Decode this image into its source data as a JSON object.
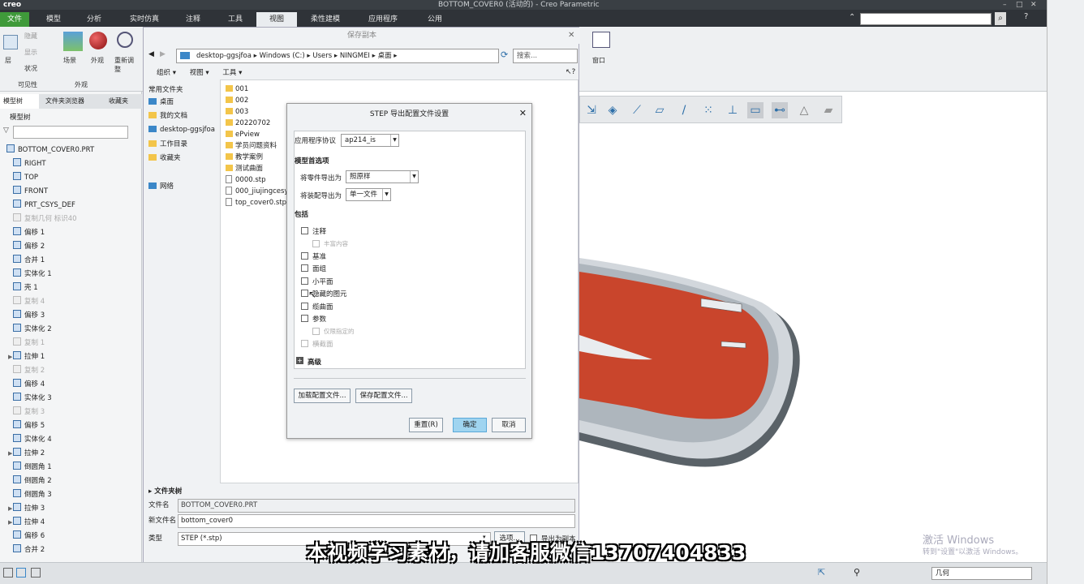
{
  "window": {
    "title": "BOTTOM_COVER0 (活动的) - Creo Parametric",
    "brand": "creo"
  },
  "ribbon": {
    "tabs": [
      "文件",
      "模型",
      "分析",
      "实时仿真",
      "注释",
      "工具",
      "视图",
      "柔性建模",
      "应用程序",
      "公用"
    ],
    "active_tab": "视图",
    "groups": {
      "visibility": {
        "label": "可见性",
        "hide": "隐藏",
        "show": "显示",
        "status": "状况",
        "layer": "层"
      },
      "appearance": {
        "label": "外观",
        "scene": "场景",
        "appearance": "外观"
      },
      "reorient": "重新调整",
      "window": "窗口"
    }
  },
  "left_panel": {
    "tabs": [
      "模型树",
      "文件夹浏览器",
      "收藏夹"
    ],
    "header": "模型树",
    "tree": [
      {
        "label": "BOTTOM_COVER0.PRT",
        "dim": false
      },
      {
        "label": "RIGHT",
        "dim": false
      },
      {
        "label": "TOP",
        "dim": false
      },
      {
        "label": "FRONT",
        "dim": false
      },
      {
        "label": "PRT_CSYS_DEF",
        "dim": false
      },
      {
        "label": "复制几何 标识40",
        "dim": true
      },
      {
        "label": "偏移 1",
        "dim": false
      },
      {
        "label": "偏移 2",
        "dim": false
      },
      {
        "label": "合并 1",
        "dim": false
      },
      {
        "label": "实体化 1",
        "dim": false
      },
      {
        "label": "壳 1",
        "dim": false
      },
      {
        "label": "复制 4",
        "dim": true
      },
      {
        "label": "偏移 3",
        "dim": false
      },
      {
        "label": "实体化 2",
        "dim": false
      },
      {
        "label": "复制 1",
        "dim": true
      },
      {
        "label": "拉伸 1",
        "dim": false,
        "expandable": true
      },
      {
        "label": "复制 2",
        "dim": true
      },
      {
        "label": "偏移 4",
        "dim": false
      },
      {
        "label": "实体化 3",
        "dim": false
      },
      {
        "label": "复制 3",
        "dim": true
      },
      {
        "label": "偏移 5",
        "dim": false
      },
      {
        "label": "实体化 4",
        "dim": false
      },
      {
        "label": "拉伸 2",
        "dim": false,
        "expandable": true
      },
      {
        "label": "倒圆角 1",
        "dim": false
      },
      {
        "label": "倒圆角 2",
        "dim": false
      },
      {
        "label": "倒圆角 3",
        "dim": false
      },
      {
        "label": "拉伸 3",
        "dim": false,
        "expandable": true
      },
      {
        "label": "拉伸 4",
        "dim": false,
        "expandable": true
      },
      {
        "label": "偏移 6",
        "dim": false
      },
      {
        "label": "合并 2",
        "dim": false
      }
    ]
  },
  "save_dialog": {
    "title": "保存副本",
    "address": [
      "desktop-ggsjfoa",
      "Windows (C:)",
      "Users",
      "NINGMEI",
      "桌面"
    ],
    "search_placeholder": "搜索...",
    "toolbar": {
      "organize": "组织",
      "view": "视图",
      "tools": "工具"
    },
    "sidebar": {
      "title": "常用文件夹",
      "items": [
        "桌面",
        "我的文档",
        "desktop-ggsjfoa",
        "工作目录",
        "收藏夹"
      ],
      "network": "网络"
    },
    "files": [
      {
        "name": "001",
        "type": "folder"
      },
      {
        "name": "002",
        "type": "folder"
      },
      {
        "name": "003",
        "type": "folder"
      },
      {
        "name": "20220702",
        "type": "folder"
      },
      {
        "name": "ePview",
        "type": "folder"
      },
      {
        "name": "学员问题资料",
        "type": "folder"
      },
      {
        "name": "教学案例",
        "type": "folder"
      },
      {
        "name": "测试曲面",
        "type": "folder"
      },
      {
        "name": "0000.stp",
        "type": "file"
      },
      {
        "name": "000_jiujingcesyi_",
        "type": "file"
      },
      {
        "name": "top_cover0.stp",
        "type": "file"
      }
    ],
    "folder_tree_label": "文件夹树",
    "filename_label": "文件名",
    "filename_value": "BOTTOM_COVER0.PRT",
    "newname_label": "新文件名",
    "newname_value": "bottom_cover0",
    "type_label": "类型",
    "type_value": "STEP (*.stp)",
    "options_button": "选项...",
    "export_checkbox": "导出为副本",
    "ok": "确定",
    "cancel": "取消"
  },
  "step_dialog": {
    "title": "STEP 导出配置文件设置",
    "protocol_label": "应用程序协议",
    "protocol_value": "ap214_is",
    "model_prefs_label": "模型首选项",
    "part_export_label": "将零件导出为",
    "part_export_value": "照原样",
    "asm_export_label": "将装配导出为",
    "asm_export_value": "单一文件",
    "include_label": "包括",
    "checks": [
      {
        "label": "注释",
        "dim": false,
        "indent": false
      },
      {
        "label": "丰富内容",
        "dim": true,
        "indent": true
      },
      {
        "label": "基准",
        "dim": false,
        "indent": false
      },
      {
        "label": "面组",
        "dim": false,
        "indent": false
      },
      {
        "label": "小平面",
        "dim": false,
        "indent": false
      },
      {
        "label": "隐藏的图元",
        "dim": false,
        "indent": false
      },
      {
        "label": "缆曲面",
        "dim": false,
        "indent": false
      },
      {
        "label": "参数",
        "dim": false,
        "indent": false
      },
      {
        "label": "仅限指定的",
        "dim": true,
        "indent": true
      },
      {
        "label": "横截面",
        "dim": true,
        "indent": false
      }
    ],
    "advanced_label": "高级",
    "load_config": "加载配置文件...",
    "save_config": "保存配置文件...",
    "reset": "重置(R)",
    "ok": "确定",
    "cancel": "取消"
  },
  "statusbar": {
    "filter_value": "几何"
  },
  "overlay": {
    "subtitle": "本视频学习素材，请加客服微信13707404833",
    "watermark_title": "激活 Windows",
    "watermark_sub": "转到\"设置\"以激活 Windows。"
  },
  "colors": {
    "accent": "#3f9a3a",
    "primary_button": "#9fd4f0",
    "model_red": "#c9452c"
  }
}
